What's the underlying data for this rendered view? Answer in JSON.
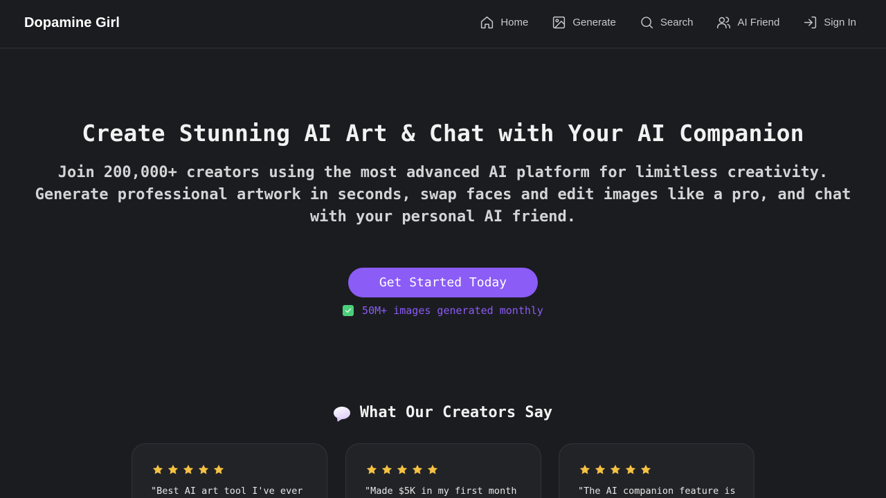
{
  "header": {
    "brand": "Dopamine Girl",
    "nav": [
      {
        "label": "Home",
        "icon": "home-icon"
      },
      {
        "label": "Generate",
        "icon": "image-icon"
      },
      {
        "label": "Search",
        "icon": "search-icon"
      },
      {
        "label": "AI Friend",
        "icon": "users-icon"
      },
      {
        "label": "Sign In",
        "icon": "sign-in-icon"
      }
    ]
  },
  "hero": {
    "title": "Create Stunning AI Art & Chat with Your AI Companion",
    "subtitle": "Join 200,000+ creators using the most advanced AI platform for limitless creativity. Generate professional artwork in seconds, swap faces and edit images like a pro, and chat with your personal AI friend.",
    "cta_label": "Get Started Today",
    "stat": "50M+ images generated monthly"
  },
  "testimonials": {
    "title": "What Our Creators Say",
    "cards": [
      {
        "rating": 5,
        "quote": "\"Best AI art tool I've ever"
      },
      {
        "rating": 5,
        "quote": "\"Made $5K in my first month"
      },
      {
        "rating": 5,
        "quote": "\"The AI companion feature is"
      }
    ]
  },
  "colors": {
    "background": "#1b1c20",
    "accent": "#8b5cf6",
    "star": "#f5c242",
    "check": "#4ccf7a"
  }
}
